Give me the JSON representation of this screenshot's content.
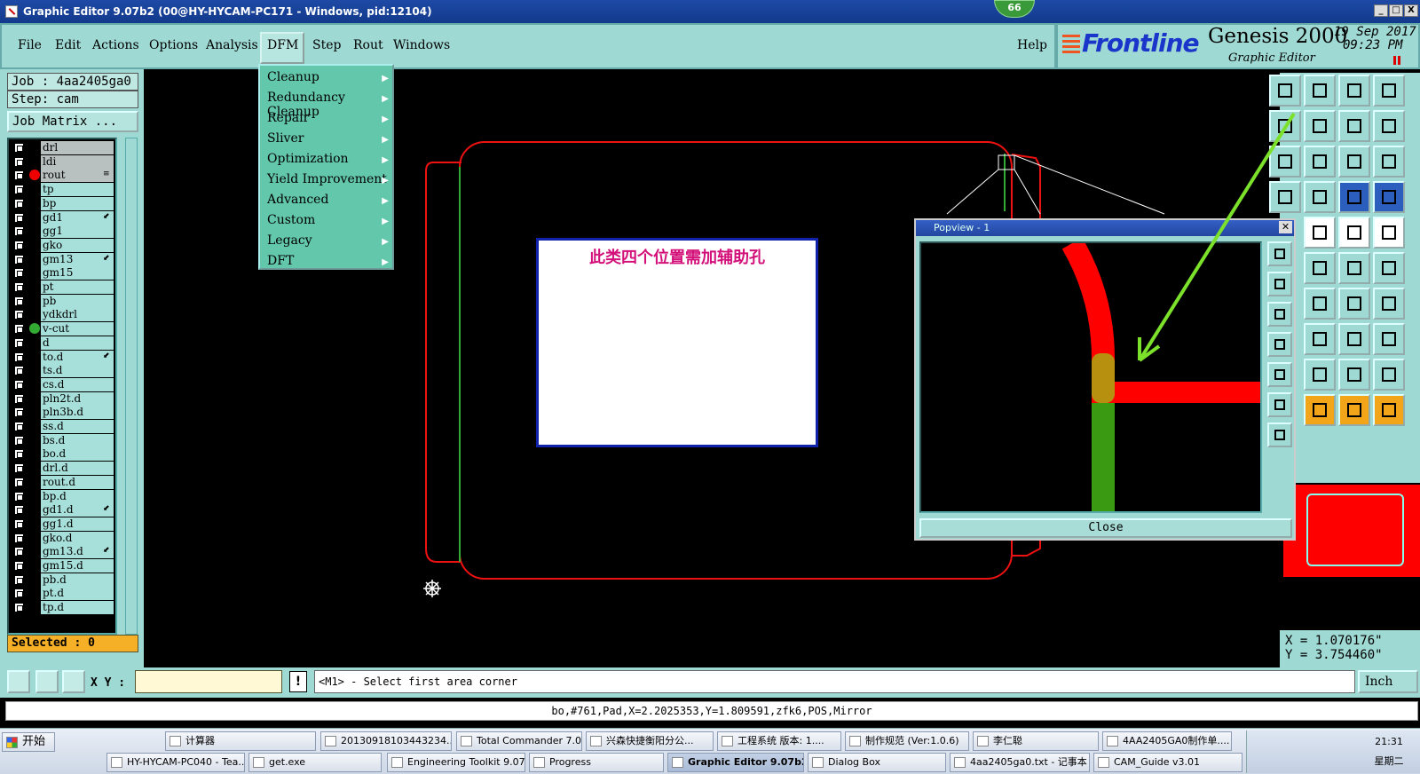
{
  "window": {
    "title": "Graphic Editor 9.07b2 (00@HY-HYCAM-PC171 - Windows, pid:12104)",
    "badge": "66",
    "min": "_",
    "max": "□",
    "close": "X"
  },
  "menu": {
    "file": "File",
    "edit": "Edit",
    "actions": "Actions",
    "options": "Options",
    "analysis": "Analysis",
    "dfm": "DFM",
    "step": "Step",
    "rout": "Rout",
    "windows": "Windows",
    "help": "Help"
  },
  "brand": {
    "logo": "Frontline",
    "product": "Genesis 2000",
    "subtitle": "Graphic Editor",
    "date_line1": "19 Sep 2017",
    "date_line2": "09:23 PM"
  },
  "job": {
    "job_line": "Job : 4aa2405ga0",
    "step_line": "Step: cam",
    "matrix_btn": "Job Matrix ..."
  },
  "layers": [
    {
      "name": "drl",
      "grey": true,
      "dot": "",
      "mark": ""
    },
    {
      "name": "ldi",
      "grey": true,
      "dot": "",
      "mark": ""
    },
    {
      "name": "rout",
      "grey": true,
      "dot": "#e00",
      "mark": "≡"
    },
    {
      "name": "tp",
      "grey": false,
      "dot": "",
      "mark": ""
    },
    {
      "name": "bp",
      "grey": false,
      "dot": "",
      "mark": ""
    },
    {
      "name": "gd1",
      "grey": false,
      "dot": "",
      "mark": "⬋"
    },
    {
      "name": "gg1",
      "grey": false,
      "dot": "",
      "mark": ""
    },
    {
      "name": "gko",
      "grey": false,
      "dot": "",
      "mark": ""
    },
    {
      "name": "gm13",
      "grey": false,
      "dot": "",
      "mark": "⬋"
    },
    {
      "name": "gm15",
      "grey": false,
      "dot": "",
      "mark": ""
    },
    {
      "name": "pt",
      "grey": false,
      "dot": "",
      "mark": ""
    },
    {
      "name": "pb",
      "grey": false,
      "dot": "",
      "mark": ""
    },
    {
      "name": "ydkdrl",
      "grey": false,
      "dot": "",
      "mark": ""
    },
    {
      "name": "v-cut",
      "grey": false,
      "dot": "#3a3",
      "mark": ""
    },
    {
      "name": "d",
      "grey": false,
      "dot": "",
      "mark": ""
    },
    {
      "name": "to.d",
      "grey": false,
      "dot": "",
      "mark": "⬋"
    },
    {
      "name": "ts.d",
      "grey": false,
      "dot": "",
      "mark": ""
    },
    {
      "name": "cs.d",
      "grey": false,
      "dot": "",
      "mark": ""
    },
    {
      "name": "pln2t.d",
      "grey": false,
      "dot": "",
      "mark": ""
    },
    {
      "name": "pln3b.d",
      "grey": false,
      "dot": "",
      "mark": ""
    },
    {
      "name": "ss.d",
      "grey": false,
      "dot": "",
      "mark": ""
    },
    {
      "name": "bs.d",
      "grey": false,
      "dot": "",
      "mark": ""
    },
    {
      "name": "bo.d",
      "grey": false,
      "dot": "",
      "mark": ""
    },
    {
      "name": "drl.d",
      "grey": false,
      "dot": "",
      "mark": ""
    },
    {
      "name": "rout.d",
      "grey": false,
      "dot": "",
      "mark": ""
    },
    {
      "name": "bp.d",
      "grey": false,
      "dot": "",
      "mark": ""
    },
    {
      "name": "gd1.d",
      "grey": false,
      "dot": "",
      "mark": "⬋"
    },
    {
      "name": "gg1.d",
      "grey": false,
      "dot": "",
      "mark": ""
    },
    {
      "name": "gko.d",
      "grey": false,
      "dot": "",
      "mark": ""
    },
    {
      "name": "gm13.d",
      "grey": false,
      "dot": "",
      "mark": "⬋"
    },
    {
      "name": "gm15.d",
      "grey": false,
      "dot": "",
      "mark": ""
    },
    {
      "name": "pb.d",
      "grey": false,
      "dot": "",
      "mark": ""
    },
    {
      "name": "pt.d",
      "grey": false,
      "dot": "",
      "mark": ""
    },
    {
      "name": "tp.d",
      "grey": false,
      "dot": "",
      "mark": ""
    }
  ],
  "selected": "Selected : 0",
  "dfm_menu": [
    "Cleanup",
    "Redundancy Cleanup",
    "Repair",
    "Sliver",
    "Optimization",
    "Yield Improvement",
    "Advanced",
    "Custom",
    "Legacy",
    "DFT"
  ],
  "note": "此类四个位置需加辅助孔",
  "popview": {
    "title": "Popview - 1",
    "close": "Close"
  },
  "coords": {
    "x": "X = 1.070176\"",
    "y": "Y = 3.754460\""
  },
  "bottom": {
    "xy_label": "X Y :",
    "warn": "!",
    "prompt": "<M1> - Select first area corner",
    "unit": "Inch",
    "status": "bo,#761,Pad,X=2.2025353,Y=1.809591,zfk6,POS,Mirror"
  },
  "taskbar": {
    "start": "开始",
    "row1": [
      "计算器",
      "2013091810344323​4...",
      "Total Commander 7.0...",
      "兴森快捷衡阳分公...",
      "工程系统  版本: 1....",
      "制作规范 (Ver:1.0.6)",
      "李仁聪",
      "4AA2405GA0制作单...."
    ],
    "row2": [
      "HY-HYCAM-PC040 - Tea...",
      "get.exe",
      "Engineering Toolkit 9.07...",
      "Progress",
      "Graphic Editor 9.07b2...",
      "Dialog Box",
      "4aa2405ga0.txt - 记事本",
      "CAM_Guide v3.01"
    ],
    "time": "21:31",
    "day": "星期二"
  }
}
